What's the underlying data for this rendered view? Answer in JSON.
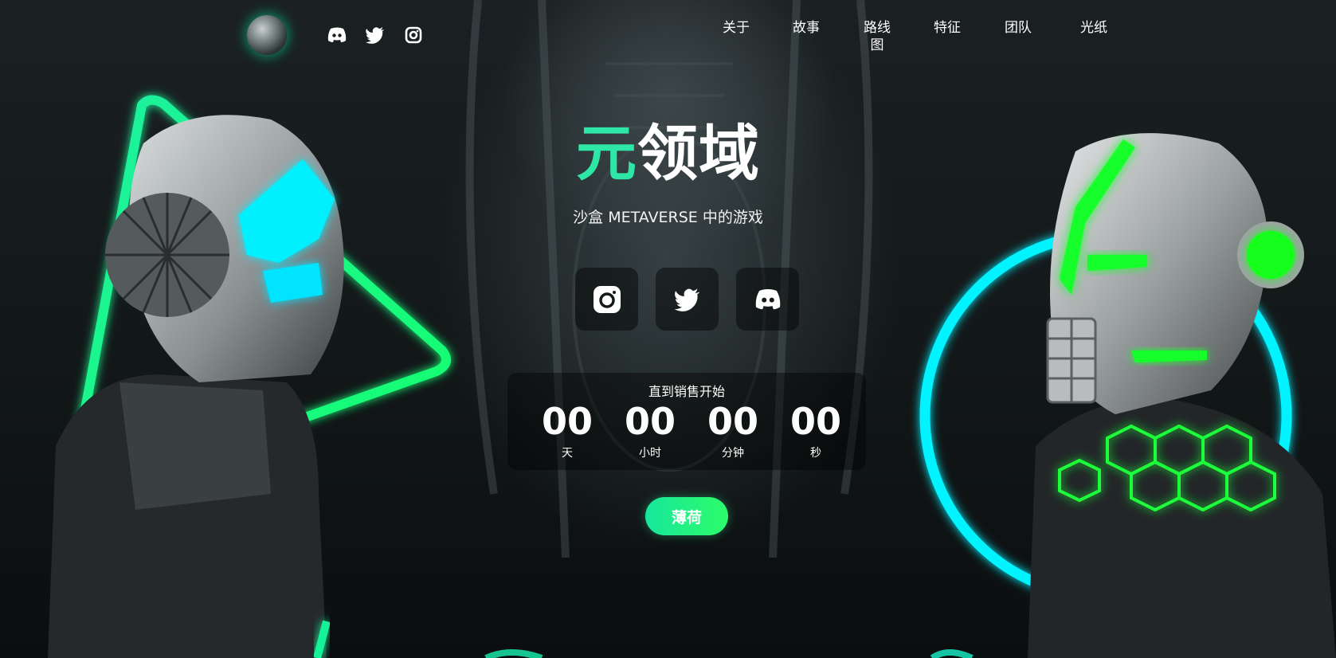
{
  "header": {
    "logo_icon": "globe-logo-icon",
    "social_icons": [
      "discord-icon",
      "twitter-icon",
      "instagram-icon"
    ],
    "nav": [
      "关于",
      "故事",
      "路线图",
      "特征",
      "团队",
      "光纸"
    ]
  },
  "hero": {
    "title_accent": "元",
    "title_rest": "领域",
    "subtitle": "沙盒 METAVERSE 中的游戏",
    "social_icons": [
      "instagram-icon",
      "twitter-icon",
      "discord-icon"
    ],
    "countdown": {
      "label": "直到销售开始",
      "units": [
        {
          "value": "00",
          "name": "天"
        },
        {
          "value": "00",
          "name": "小时"
        },
        {
          "value": "00",
          "name": "分钟"
        },
        {
          "value": "00",
          "name": "秒"
        }
      ]
    },
    "mint_label": "薄荷"
  },
  "colors": {
    "accent": "#2ee6a6",
    "neon_green": "#1ef77a",
    "neon_cyan": "#00f0ff",
    "background": "#0d1112"
  }
}
